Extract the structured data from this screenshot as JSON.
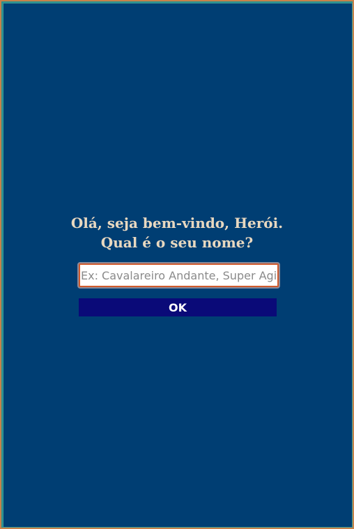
{
  "greeting": {
    "line1": "Olá, seja bem-vindo, Herói.",
    "line2": "Qual é o seu nome?"
  },
  "name_input": {
    "value": "",
    "placeholder": "Ex: Cavalareiro Andante, Super Agito"
  },
  "ok_button": {
    "label": "OK"
  },
  "colors": {
    "background": "#003e73",
    "border": "#c8824a",
    "text": "#e8d8c0",
    "button": "#0a0a78",
    "input_border": "#d05a2c"
  }
}
